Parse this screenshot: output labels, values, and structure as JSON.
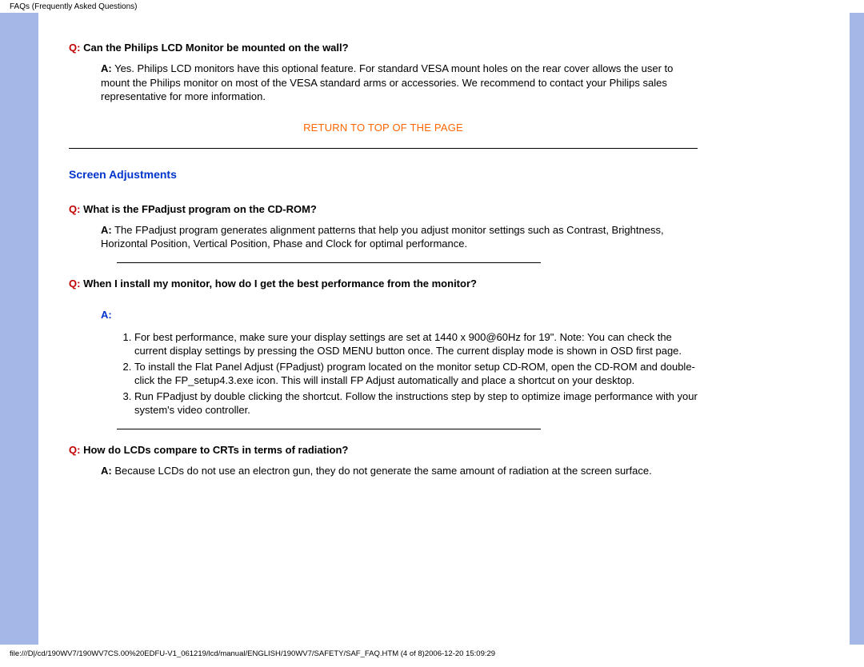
{
  "header": "FAQs (Frequently Asked Questions)",
  "q1": {
    "label": "Q:",
    "text": "Can the Philips LCD Monitor be mounted on the wall?",
    "a_label": "A:",
    "a_text": " Yes. Philips LCD monitors have this optional feature. For standard VESA mount holes on the rear cover allows the user to mount the Philips monitor on most of the VESA standard arms or accessories. We recommend to contact your Philips sales representative for more information."
  },
  "return_link": "RETURN TO TOP OF THE PAGE",
  "section_heading": "Screen Adjustments",
  "q2": {
    "label": "Q:",
    "text": "What is the FPadjust program on the CD-ROM?",
    "a_label": "A:",
    "a_text": " The FPadjust program generates alignment patterns that help you adjust monitor settings such as Contrast, Brightness, Horizontal Position, Vertical Position, Phase and Clock for optimal performance."
  },
  "q3": {
    "label": "Q:",
    "text": "When I install my monitor, how do I get the best performance from the monitor?",
    "a_label": "A:",
    "steps": [
      "For best performance, make sure your display settings are set at 1440 x 900@60Hz for 19\". Note: You can check the current display settings by pressing the OSD MENU button once. The current display mode is shown in OSD first page.",
      "To install the Flat Panel Adjust (FPadjust) program located on the monitor setup CD-ROM, open the CD-ROM and double-click the FP_setup4.3.exe icon. This will install FP Adjust automatically and place a shortcut on your desktop.",
      "Run FPadjust by double clicking the shortcut. Follow the instructions step by step to optimize image performance with your system's video controller."
    ]
  },
  "q4": {
    "label": "Q:",
    "text": "How do LCDs compare to CRTs in terms of radiation?",
    "a_label": "A:",
    "a_text": " Because LCDs do not use an electron gun, they do not generate the same amount of radiation at the screen surface."
  },
  "footer": "file:///D|/cd/190WV7/190WV7CS.00%20EDFU-V1_061219/lcd/manual/ENGLISH/190WV7/SAFETY/SAF_FAQ.HTM (4 of 8)2006-12-20 15:09:29"
}
